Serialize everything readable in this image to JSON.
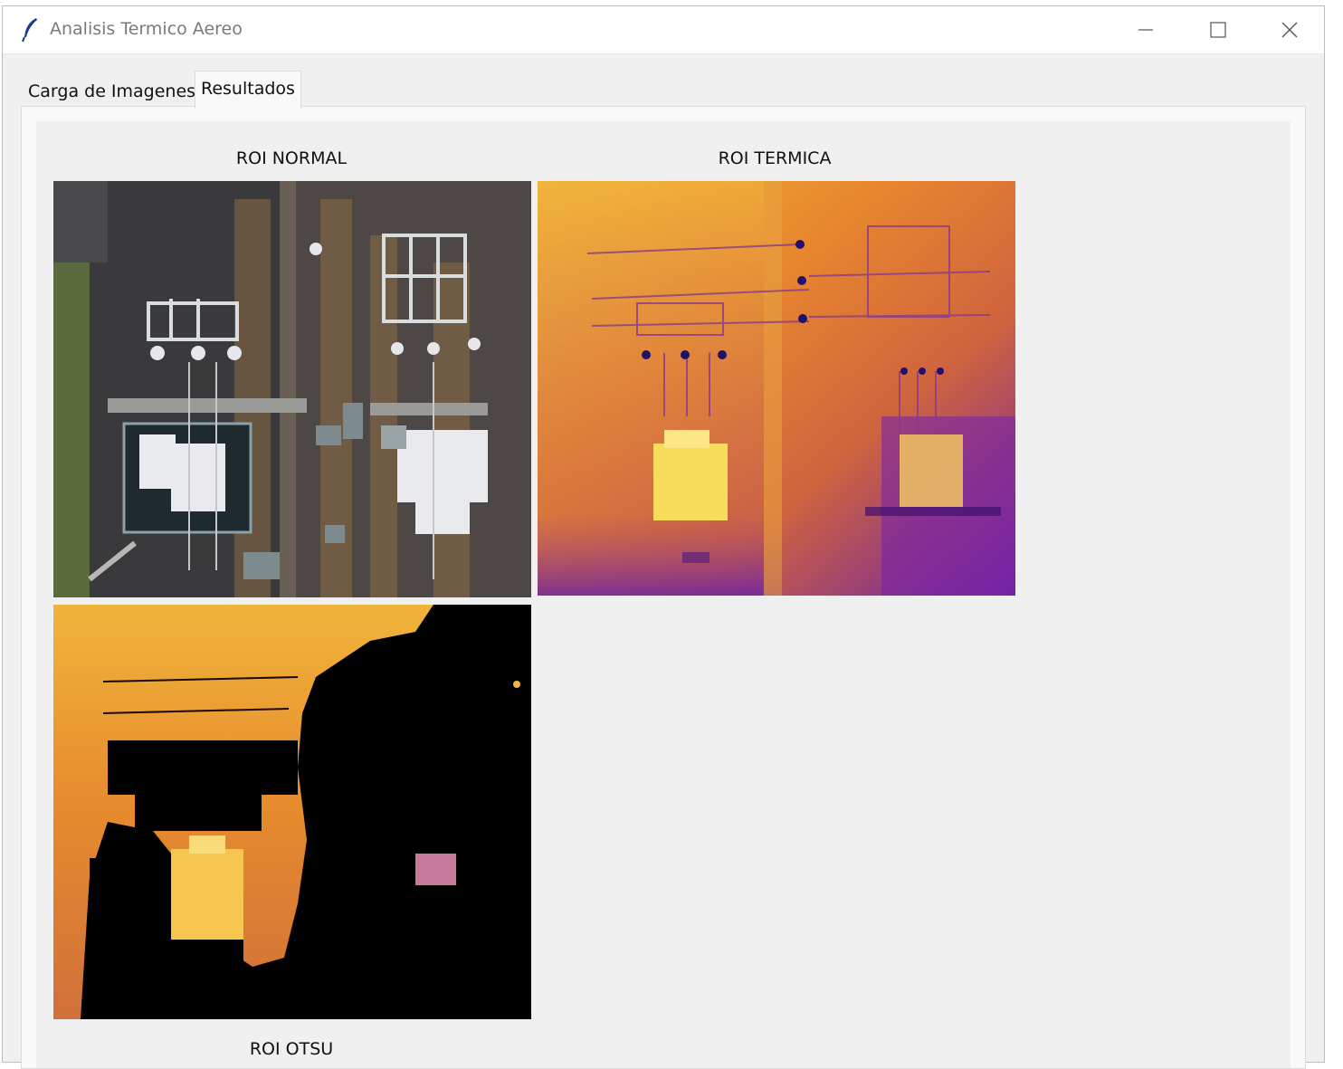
{
  "window": {
    "title": "Analisis Termico Aereo",
    "app_icon": "feather-icon",
    "controls": [
      "minimize-icon",
      "maximize-icon",
      "close-icon"
    ]
  },
  "tabs": [
    {
      "label": "Carga de Imagenes",
      "selected": false
    },
    {
      "label": "Resultados",
      "selected": true
    }
  ],
  "results": {
    "roi_normal_label": "ROI NORMAL",
    "roi_termica_label": "ROI TERMICA",
    "roi_otsu_label": "ROI OTSU"
  },
  "colors": {
    "thermal_hot": "#f5c842",
    "thermal_mid": "#e6892e",
    "thermal_cold": "#7a1fa8",
    "otsu_background": "#000000"
  }
}
